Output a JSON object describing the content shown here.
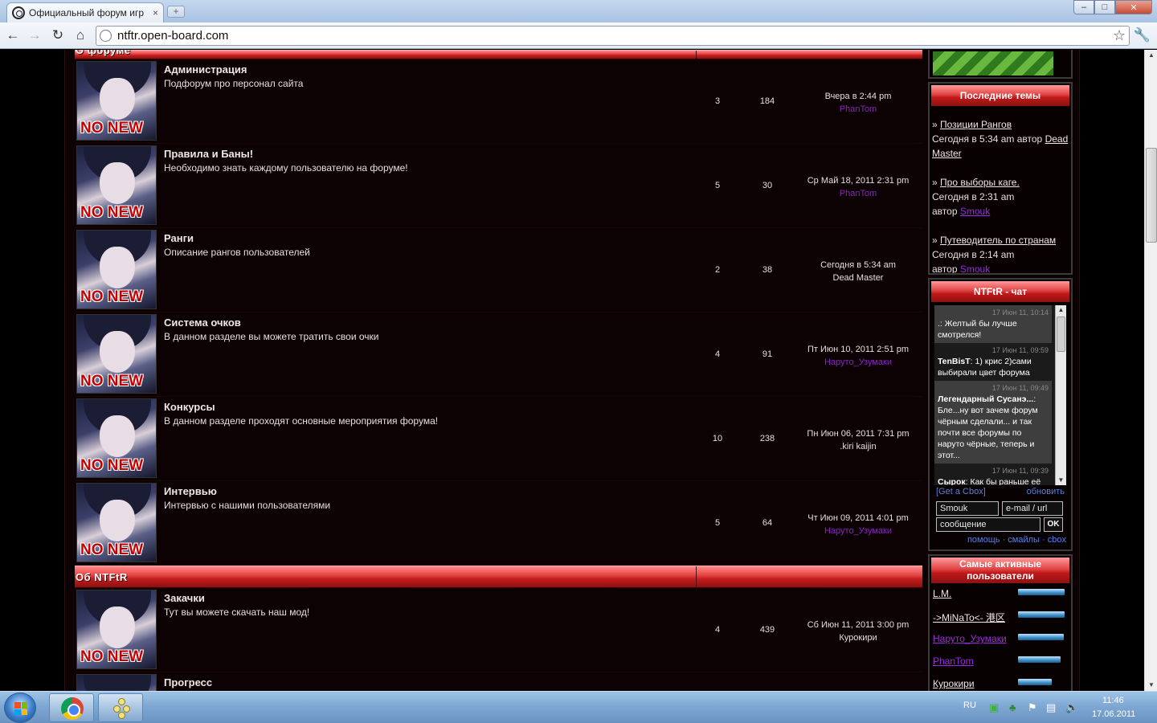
{
  "browser": {
    "tab_title": "Официальный форум игр",
    "tab_close": "×",
    "new_tab": "+",
    "url": "ntftr.open-board.com",
    "back": "←",
    "forward": "→",
    "reload": "↻",
    "home": "⌂",
    "star": "☆",
    "wrench": "🔧",
    "min": "–",
    "max": "□",
    "close": "✕"
  },
  "categories": [
    {
      "title": "О форуме"
    },
    {
      "title": "Об NTFtR"
    }
  ],
  "forums": [
    {
      "name": "Администрация",
      "desc": "Подфорум про персонал сайта",
      "topics": "3",
      "posts": "184",
      "last_date": "Вчера в 2:44 pm",
      "last_user": "PhanTom",
      "user_color": "purple"
    },
    {
      "name": "Правила и Баны!",
      "desc": "Необходимо знать каждому пользователю на форуме!",
      "topics": "5",
      "posts": "30",
      "last_date": "Ср Май 18, 2011 2:31 pm",
      "last_user": "PhanTom",
      "user_color": "purple"
    },
    {
      "name": "Ранги",
      "desc": "Описание рангов пользователей",
      "topics": "2",
      "posts": "38",
      "last_date": "Сегодня в 5:34 am",
      "last_user": "Dead Master",
      "user_color": "white"
    },
    {
      "name": "Система очков",
      "desc": "В данном разделе вы можете тратить свои очки",
      "topics": "4",
      "posts": "91",
      "last_date": "Пт Июн 10, 2011 2:51 pm",
      "last_user": "Наруто_Узумаки",
      "user_color": "purple"
    },
    {
      "name": "Конкурсы",
      "desc": "В данном разделе проходят основные мероприятия форума!",
      "topics": "10",
      "posts": "238",
      "last_date": "Пн Июн 06, 2011 7:31 pm",
      "last_user": ".kiri kaijin",
      "user_color": "white"
    },
    {
      "name": "Интервью",
      "desc": "Интервью с нашими пользователями",
      "topics": "5",
      "posts": "64",
      "last_date": "Чт Июн 09, 2011 4:01 pm",
      "last_user": "Наруто_Узумаки",
      "user_color": "purple"
    },
    {
      "name": "Закачки",
      "desc": "Тут вы можете скачать наш мод!",
      "topics": "4",
      "posts": "439",
      "last_date": "Сб Июн 11, 2011 3:00 pm",
      "last_user": "Курокири",
      "user_color": "white"
    },
    {
      "name": "Прогресс",
      "desc": "",
      "topics": "",
      "posts": "",
      "last_date": "",
      "last_user": "",
      "user_color": "white"
    }
  ],
  "no_new_label": "NO NEW",
  "sidebar": {
    "latest_title": "Последние темы",
    "latest": [
      {
        "topic": "Позиции Рангов",
        "when": "Сегодня в 5:34 am автор",
        "author": "Dead Master",
        "author_color": "white"
      },
      {
        "topic": "Про выборы каге.",
        "when": "Сегодня в 2:31 am",
        "by": "автор",
        "author": "Smouk",
        "author_color": "purple"
      },
      {
        "topic": "Путеводитель по странам",
        "when": "Сегодня в 2:14 am",
        "by": "автор",
        "author": "Smouk",
        "author_color": "purple"
      }
    ],
    "chat_title": "NTFtR - чат",
    "chat": [
      {
        "date": "17 Июн 11, 10:14",
        "user": "",
        "text": ".: Желтый бы лучше смотрелся!"
      },
      {
        "date": "17 Июн 11, 09:59",
        "user": "TenBisT",
        "text": ": 1) крис 2)сами выбирали цвет форума"
      },
      {
        "date": "17 Июн 11, 09:49",
        "user": "Легендарный Сусанэ...",
        "text": ": Бле...ну вот зачем форум чёрным сделали... и так почти все форумы по наруто чёрные, теперь и этот..."
      },
      {
        "date": "17 Июн 11, 09:39",
        "user": "Сырок",
        "text": ": Как бы раньше её не было вообще"
      }
    ],
    "chat_get": "[Get a Cbox]",
    "chat_refresh": "обновить",
    "chat_name": "Smouk",
    "chat_email": "e-mail / url",
    "chat_message": "сообщение",
    "chat_ok": "OK",
    "chat_help": "помощь",
    "chat_smileys": "смайлы",
    "chat_cbox": "cbox",
    "chat_sep": "·",
    "active_title": "Самые активные пользователи",
    "active": [
      {
        "name": "L.M.",
        "color": "white",
        "level": 100
      },
      {
        "name": "->MiNaTo<- 港区",
        "color": "white",
        "level": 100
      },
      {
        "name": "Наруто_Узумаки",
        "color": "purple",
        "level": 98
      },
      {
        "name": "PhanTom",
        "color": "purple",
        "level": 92
      },
      {
        "name": "Курокири",
        "color": "white",
        "level": 72
      }
    ]
  },
  "taskbar": {
    "lang": "RU",
    "time": "11:46",
    "date": "17.06.2011"
  }
}
